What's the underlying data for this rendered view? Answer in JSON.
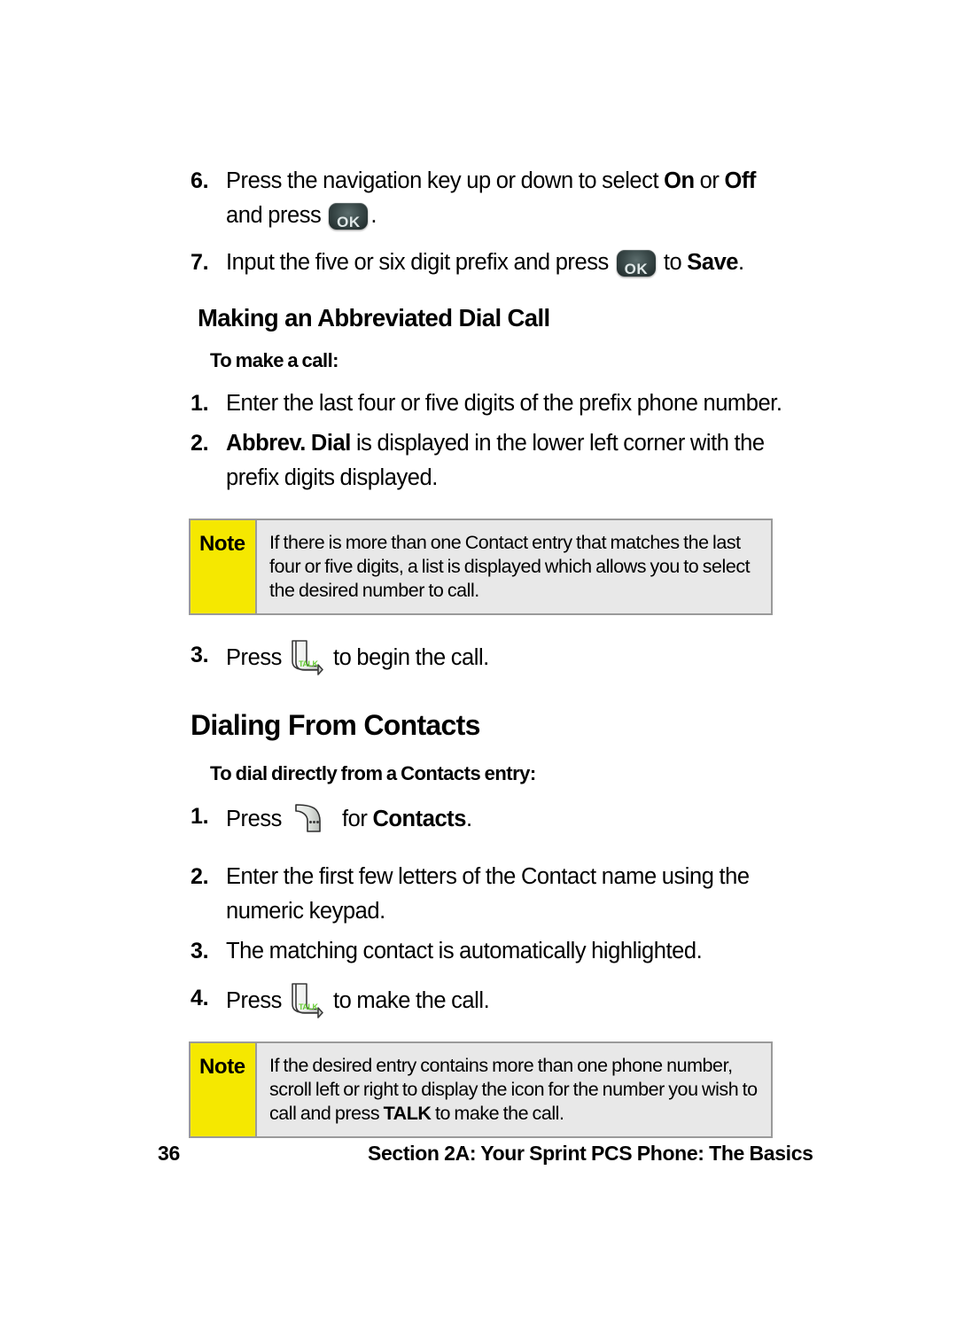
{
  "document": {
    "page_number": "36",
    "footer_title": "Section 2A: Your Sprint PCS Phone: The Basics"
  },
  "colors": {
    "note_label_bg": "#F5E800",
    "note_body_bg": "#E8E8E8",
    "note_border": "#9A9A9A",
    "talk_text": "#66CC33",
    "page_bg": "#FFFFFF"
  },
  "icons": {
    "ok_key_label": "OK",
    "talk_key_label": "TALK"
  },
  "steps_top": [
    {
      "num": "6.",
      "pre": "Press the navigation key up or down to select ",
      "bold1": "On",
      "mid": " or ",
      "bold2": "Off",
      "post": " and press ",
      "tail": "."
    },
    {
      "num": "7.",
      "pre": "Input the five or six digit prefix and press ",
      "mid": " to ",
      "bold1": "Save",
      "tail": "."
    }
  ],
  "section_abbrev": {
    "heading": "Making an Abbreviated Dial Call",
    "subheading": "To make a call:",
    "steps": [
      {
        "num": "1.",
        "text": "Enter the last four or five digits of the prefix phone number."
      },
      {
        "num": "2.",
        "bold_lead": "Abbrev. Dial",
        "text": " is displayed in the lower left corner with the prefix digits displayed."
      }
    ],
    "note": {
      "label": "Note",
      "text": "If there is more than one Contact entry that matches the last four or five digits, a list is displayed which allows you to select the desired number to call."
    },
    "step3": {
      "num": "3.",
      "pre": "Press ",
      "post": " to begin the call."
    }
  },
  "section_contacts": {
    "heading": "Dialing From Contacts",
    "subheading": "To dial directly from a Contacts entry:",
    "step1": {
      "num": "1.",
      "pre": "Press ",
      "mid": " for ",
      "bold1": "Contacts",
      "tail": "."
    },
    "steps": [
      {
        "num": "2.",
        "text": "Enter the first few letters of the Contact name using the numeric keypad."
      },
      {
        "num": "3.",
        "text": "The matching contact is automatically highlighted."
      }
    ],
    "step4": {
      "num": "4.",
      "pre": "Press ",
      "post": " to make the call."
    },
    "note": {
      "label": "Note",
      "text_part1": "If the desired entry contains more than one phone number, scroll left or right to display the icon for the number you wish to call and press ",
      "bold_word": "TALK",
      "text_part2": " to make the call."
    }
  }
}
